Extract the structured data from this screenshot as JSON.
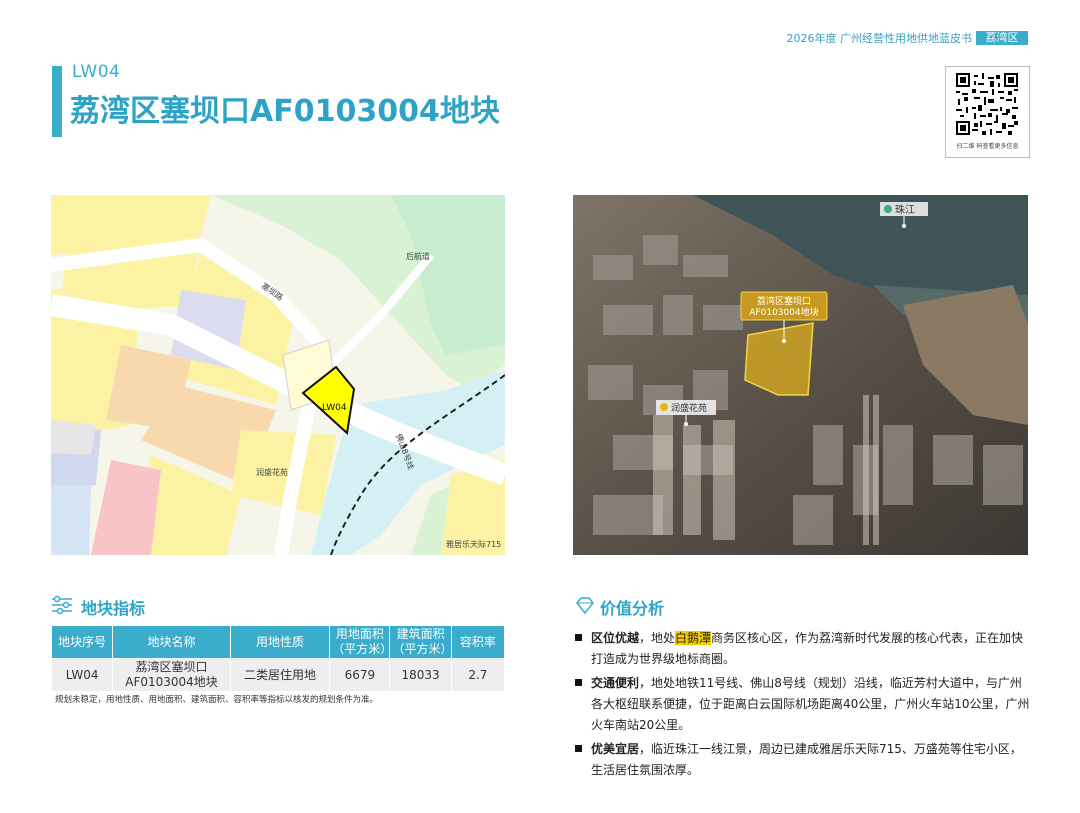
{
  "header": {
    "publication": "2026年度 广州经营性用地供地蓝皮书",
    "district_tag": "荔湾区"
  },
  "plot": {
    "code": "LW04",
    "title": "荔湾区塞坝口AF0103004地块"
  },
  "qr": {
    "caption": "扫二维 码查看更多信息"
  },
  "map": {
    "road_label": "塞坝路",
    "park_label": "后航道",
    "parcel_label": "LW04",
    "neighborhood_label": "润盛花苑",
    "metro_label": "佛山8号线",
    "corner_label": "雅居乐天际715"
  },
  "aerial": {
    "river_label": "珠江",
    "plot_label_line1": "荔湾区塞坝口",
    "plot_label_line2": "AF0103004地块",
    "neighborhood_label": "润盛花苑"
  },
  "indicators": {
    "section_title": "地块指标",
    "columns": [
      "地块序号",
      "地块名称",
      "用地性质",
      "用地面积\n（平方米）",
      "建筑面积\n（平方米）",
      "容积率"
    ],
    "row": {
      "code": "LW04",
      "name": "荔湾区塞坝口\nAF0103004地块",
      "land_use": "二类居住用地",
      "land_area": "6679",
      "floor_area": "18033",
      "far": "2.7"
    },
    "note": "规划未稳定，用地性质、用地面积、建筑面积、容积率等指标以核发的规划条件为准。"
  },
  "analysis": {
    "section_title": "价值分析",
    "items": [
      {
        "head": "区位优越",
        "pre": "，地处",
        "highlight": "白鹅潭",
        "post": "商务区核心区，作为荔湾新时代发展的核心代表，正在加快打造成为世界级地标商圈。"
      },
      {
        "head": "交通便利",
        "pre": "，地处地铁11号线、佛山8号线（规划）沿线，临近芳村大道中，与广州各大枢纽联系便捷，位于距离白云国际机场距离40公里，广州火车站10公里，广州火车南站20公里。",
        "highlight": "",
        "post": ""
      },
      {
        "head": "优美宜居",
        "pre": "，临近珠江一线江景，周边已建成雅居乐天际715、万盛苑等住宅小区，生活居住氛围浓厚。",
        "highlight": "",
        "post": ""
      }
    ]
  },
  "colors": {
    "accent": "#3aaccc",
    "highlight": "#f5d000",
    "parcel": "#ffff00"
  }
}
